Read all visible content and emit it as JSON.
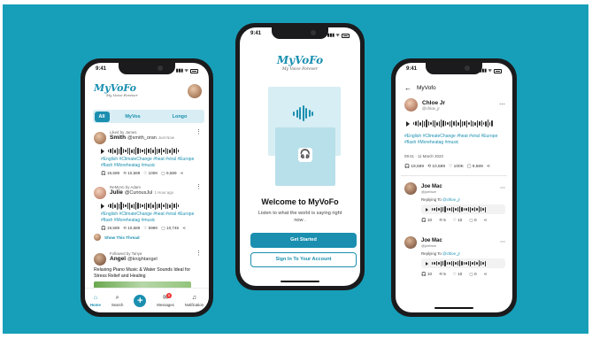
{
  "status_time": "9:41",
  "brand": {
    "logo": "MyVoFo",
    "tagline": "My Voice Forever"
  },
  "feed": {
    "tabs": [
      "All",
      "MyVos",
      "Longo"
    ],
    "active_tab": "All",
    "posts": [
      {
        "context": "Liked by James",
        "name": "Smith",
        "handle": "@smith_oran",
        "time": "Just Now",
        "tags": "#English #ClimateChange #heat #viral #Europe #flash #Moreheatag #music",
        "stats": {
          "listens": "19,589",
          "reposts": "10,589",
          "likes": "100K",
          "comments": "9,589"
        }
      },
      {
        "context": "ReMyVo by Adam",
        "name": "Julie",
        "handle": "@CuriousJul",
        "time": "1 Hour ago",
        "tags": "#English #ClimateChange #heat #viral #Europe #flash #Moreheatag #music",
        "stats": {
          "listens": "19,589",
          "reposts": "10,589",
          "likes": "599K",
          "comments": "10,745"
        },
        "thread_link": "Show This Thread"
      },
      {
        "context": "Followed by Tanya",
        "name": "Angel",
        "handle": "@knightangel",
        "text": "Relaxing Piano Music & Water Sounds Ideal for Stress Relief and Healing"
      }
    ],
    "nav": [
      {
        "label": "Home",
        "icon": "home-icon"
      },
      {
        "label": "Search",
        "icon": "search-icon"
      },
      {
        "label": "",
        "icon": "plus-icon"
      },
      {
        "label": "Messages",
        "icon": "messages-icon",
        "badge": "8"
      },
      {
        "label": "Notification",
        "icon": "bell-icon"
      }
    ]
  },
  "welcome": {
    "title": "Welcome to MyVoFo",
    "subtitle": "Listen to what the world is saying right now .",
    "get_started": "Get Started",
    "sign_in": "Sign In To Your Account"
  },
  "detail": {
    "header": "MyVofo",
    "author": {
      "name": "Chloe Jr",
      "handle": "@chloe_jr"
    },
    "tags": "#English #ClimateChange #heat #viral #Europe #flash #Moreheatag #music",
    "timestamp": "09:41 · 11 March 2023",
    "stats": {
      "listens": "19,589",
      "reposts": "10,589",
      "likes": "100K",
      "comments": "9,589"
    },
    "replies": [
      {
        "name": "Joe Mac",
        "handle": "@joeface",
        "replying": "Replying To",
        "to": "@chloe_jr",
        "stats": {
          "listens": "10",
          "reposts": "5",
          "likes": "10",
          "comments": "0"
        }
      },
      {
        "name": "Joe Mac",
        "handle": "@joeface",
        "replying": "Replying To",
        "to": "@chloe_jr",
        "stats": {
          "listens": "10",
          "reposts": "5",
          "likes": "10",
          "comments": "0"
        }
      }
    ]
  },
  "colors": {
    "background": "#179fb9",
    "accent": "#1a8fb0"
  }
}
